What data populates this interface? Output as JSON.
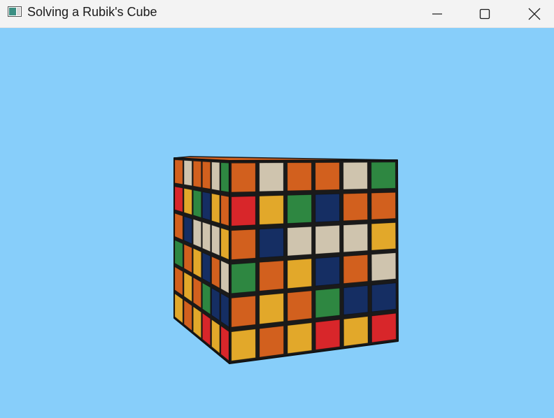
{
  "window": {
    "title": "Solving a Rubik's Cube",
    "background": "#87CEFA"
  },
  "controls": {
    "minimize_icon": "minimize-icon",
    "maximize_icon": "maximize-icon",
    "close_icon": "close-icon"
  },
  "cube": {
    "colors": {
      "O": "#D2601E",
      "W": "#CFC4AE",
      "G": "#2E8741",
      "B": "#152E63",
      "Y": "#E2A82A",
      "R": "#D8262A"
    },
    "front_face": [
      [
        "O",
        "W",
        "O",
        "O",
        "W",
        "G"
      ],
      [
        "R",
        "Y",
        "G",
        "B",
        "O",
        "O"
      ],
      [
        "O",
        "B",
        "W",
        "W",
        "W",
        "Y"
      ],
      [
        "G",
        "O",
        "Y",
        "B",
        "O",
        "W"
      ],
      [
        "O",
        "Y",
        "O",
        "G",
        "B",
        "B"
      ],
      [
        "Y",
        "O",
        "Y",
        "R",
        "Y",
        "R"
      ]
    ],
    "left_face": [
      [
        "O",
        "W",
        "O",
        "O",
        "W",
        "G"
      ],
      [
        "R",
        "Y",
        "G",
        "B",
        "Y",
        "O"
      ],
      [
        "O",
        "B",
        "W",
        "W",
        "W",
        "Y"
      ],
      [
        "G",
        "O",
        "Y",
        "B",
        "O",
        "W"
      ],
      [
        "O",
        "Y",
        "O",
        "G",
        "B",
        "B"
      ],
      [
        "Y",
        "O",
        "Y",
        "R",
        "Y",
        "R"
      ]
    ]
  }
}
